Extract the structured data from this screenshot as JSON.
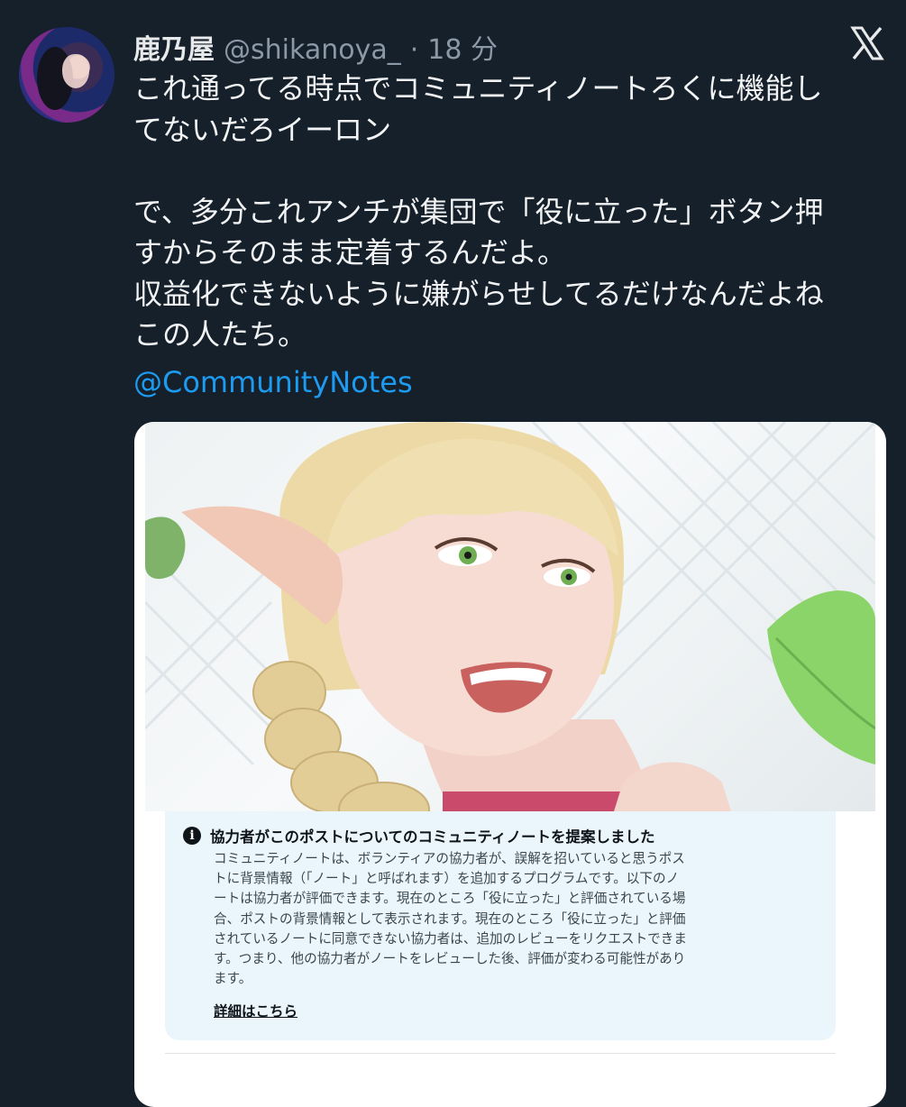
{
  "tweet": {
    "display_name": "鹿乃屋",
    "handle": "@shikanoya_",
    "separator": "·",
    "time": "18 分",
    "text": "これ通ってる時点でコミュニティノートろくに機能し\nてないだろイーロン\n\nで、多分これアンチが集団で「役に立った」ボタン押\nすからそのまま定着するんだよ。\n収益化できないように嫌がらせしてるだけなんだよね\nこの人たち。",
    "mention": "@CommunityNotes"
  },
  "icons": {
    "brand": "x-logo-icon",
    "avatar": "avatar",
    "note_info": "info-icon"
  },
  "community_note": {
    "title": "協力者がこのポストについてのコミュニティノートを提案しました",
    "info_glyph": "i",
    "lines": [
      "コミュニティノートは、ボランティアの協力者が、誤解を招いていると思うポス",
      "トに背景情報（「ノート」と呼ばれます）を追加するプログラムです。以下のノ",
      "ートは協力者が評価できます。現在のところ「役に立った」と評価されている場",
      "合、ポストの背景情報として表示されます。現在のところ「役に立った」と評価",
      "されているノートに同意できない協力者は、追加のレビューをリクエストできま",
      "す。つまり、他の協力者がノートをレビューした後、評価が変わる可能性があり",
      "ます。"
    ],
    "link": "詳細はこちら"
  },
  "colors": {
    "background": "#15202b",
    "link": "#1d9bf0",
    "note_background": "#eaf6fc"
  }
}
